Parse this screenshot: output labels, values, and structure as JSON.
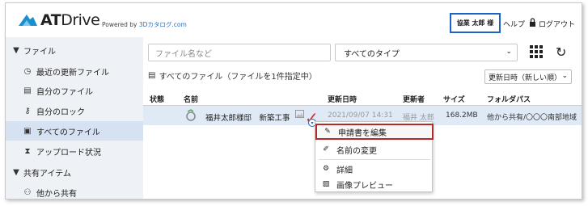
{
  "header": {
    "logo_bold": "AT",
    "logo_rest": "Drive",
    "powered_by": "Powered by",
    "powered_link": "3Dカタログ.com",
    "user": "協業 太郎 様",
    "help": "ヘルプ",
    "logout": "ログアウト"
  },
  "sidebar": {
    "items": [
      {
        "label": "ファイル",
        "icon": "caret-down-icon"
      },
      {
        "label": "最近の更新ファイル",
        "icon": "clock-icon"
      },
      {
        "label": "自分のファイル",
        "icon": "document-icon"
      },
      {
        "label": "自分のロック",
        "icon": "key-icon"
      },
      {
        "label": "すべてのファイル",
        "icon": "documents-icon"
      },
      {
        "label": "アップロード状況",
        "icon": "hourglass-icon"
      },
      {
        "label": "共有アイテム",
        "icon": "caret-down-icon"
      },
      {
        "label": "他から共有",
        "icon": "people-icon"
      }
    ]
  },
  "main": {
    "search_placeholder": "ファイル名など",
    "type_filter": "すべてのタイプ",
    "list_title": "すべてのファイル（ファイルを1件指定中）",
    "sort": "更新日時（新しい順）",
    "columns": [
      "状態",
      "名前",
      "更新日時",
      "更新者",
      "サイズ",
      "フォルダパス"
    ],
    "row": {
      "name": "福井太郎様邸　新築工事",
      "updated": "2021/09/07 14:31",
      "updater": "福井 太郎",
      "size": "168.2MB",
      "folder": "他から共有/〇〇〇南部地域"
    }
  },
  "context_menu": {
    "items": [
      {
        "label": "申請書を編集",
        "icon": "edit-icon"
      },
      {
        "label": "名前の変更",
        "icon": "pencil-icon"
      },
      {
        "label": "詳細",
        "icon": "gear-icon"
      },
      {
        "label": "画像プレビュー",
        "icon": "image-icon"
      }
    ]
  },
  "colors": {
    "accent": "#1b63c4",
    "highlight_border": "#b22a2a",
    "sidebar_bg": "#eef1f5",
    "selected_row": "#dfeaf6"
  }
}
